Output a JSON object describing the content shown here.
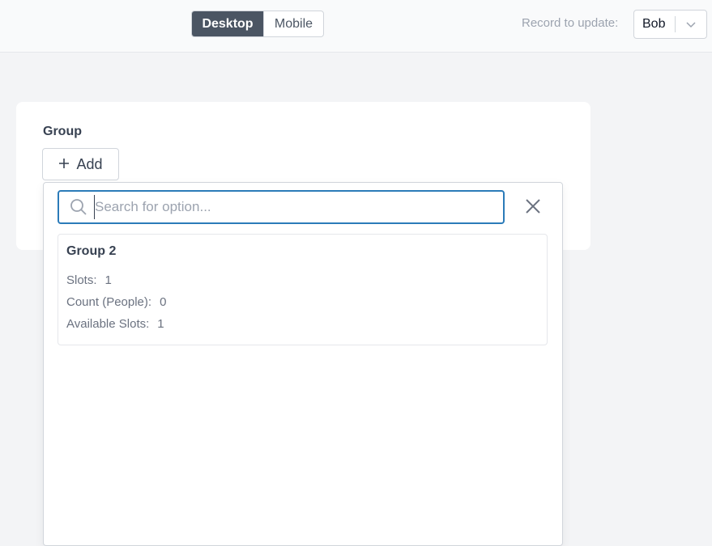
{
  "view_toggle": {
    "desktop_label": "Desktop",
    "mobile_label": "Mobile",
    "selected": "Desktop"
  },
  "record": {
    "label": "Record to update:",
    "value": "Bob"
  },
  "field": {
    "label": "Group",
    "add_label": "Add"
  },
  "dropdown": {
    "search_placeholder": "Search for option...",
    "search_value": "",
    "options": [
      {
        "title": "Group 2",
        "rows": [
          {
            "label": "Slots:",
            "value": "1"
          },
          {
            "label": "Count (People):",
            "value": "0"
          },
          {
            "label": "Available Slots:",
            "value": "1"
          }
        ]
      }
    ]
  },
  "colors": {
    "accent": "#2b7bb9",
    "active_toggle": "#4b5563",
    "background": "#f3f4f6"
  }
}
